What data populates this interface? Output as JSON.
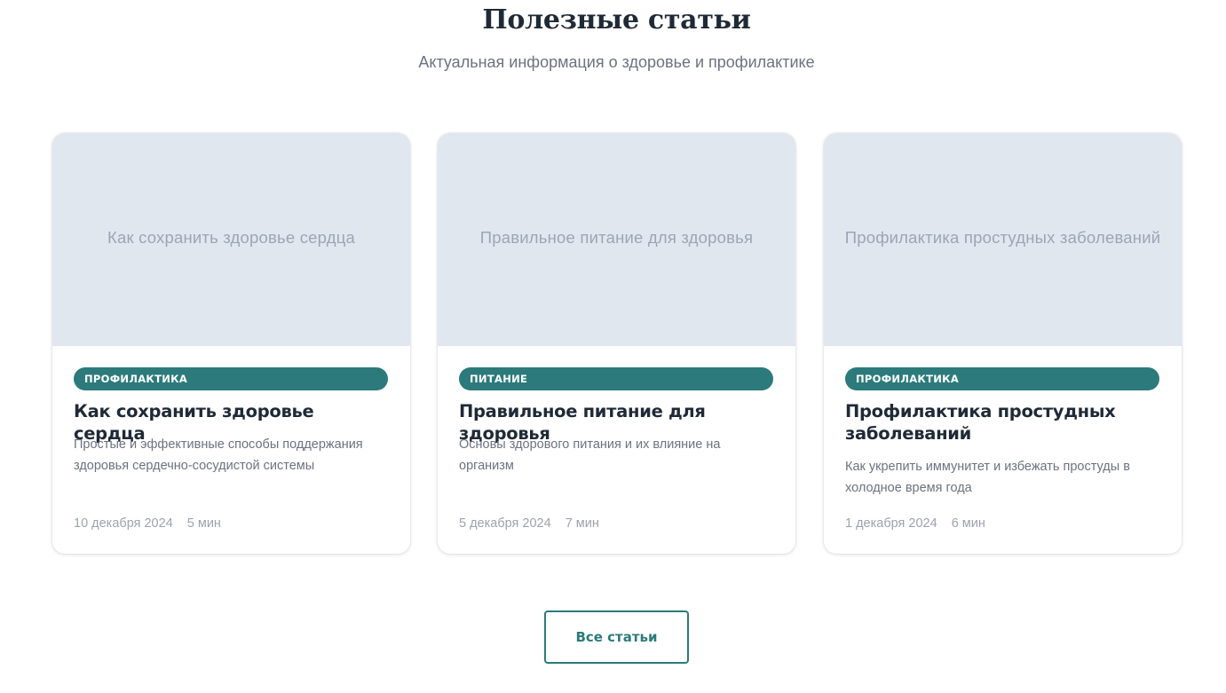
{
  "section": {
    "title": "Полезные статьи",
    "subtitle": "Актуальная информация о здоровье и профилактике"
  },
  "articles": [
    {
      "image_alt": "Как сохранить здоровье сердца",
      "tag": "ПРОФИЛАКТИКА",
      "title": "Как сохранить здоровье сердца",
      "description": "Простые и эффективные способы поддержания здоровья сердечно-сосудистой системы",
      "date": "10 декабря 2024",
      "read_time": "5 мин"
    },
    {
      "image_alt": "Правильное питание для здоровья",
      "tag": "ПИТАНИЕ",
      "title": "Правильное питание для здоровья",
      "description": "Основы здорового питания и их влияние на организм",
      "date": "5 декабря 2024",
      "read_time": "7 мин"
    },
    {
      "image_alt": "Профилактика простудных заболеваний",
      "tag": "ПРОФИЛАКТИКА",
      "title": "Профилактика простудных заболеваний",
      "description": "Как укрепить иммунитет и избежать простуды в холодное время года",
      "date": "1 декабря 2024",
      "read_time": "6 мин"
    }
  ],
  "all_articles_button": "Все статьи",
  "colors": {
    "accent": "#2c7a7b",
    "heading": "#1f2a37",
    "muted_text": "#6b7280",
    "meta_text": "#9ca3af",
    "image_placeholder": "#e1e7ef"
  }
}
